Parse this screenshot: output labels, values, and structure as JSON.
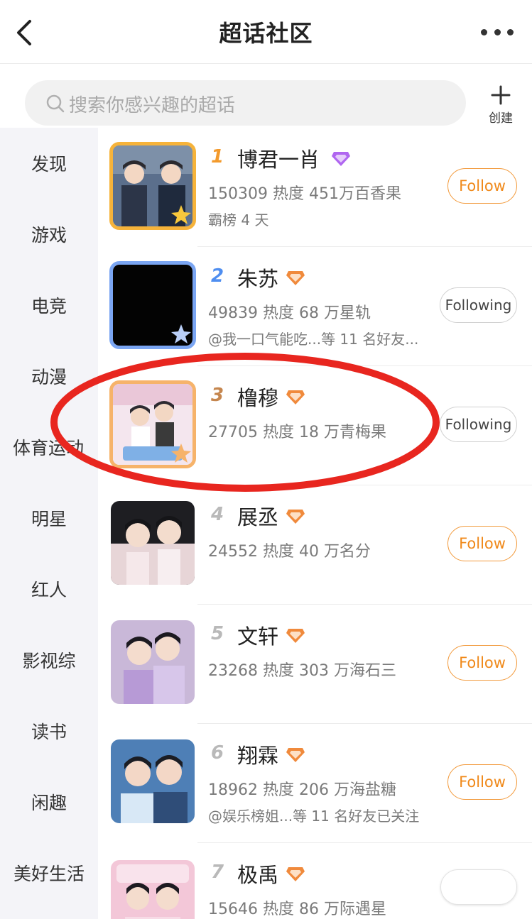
{
  "header": {
    "title": "超话社区",
    "back_icon": "chevron-left-icon",
    "more_icon": "more-dots-icon"
  },
  "search": {
    "placeholder": "搜索你感兴趣的超话",
    "create_label": "创建"
  },
  "sidebar": {
    "items": [
      {
        "label": "发现"
      },
      {
        "label": "游戏"
      },
      {
        "label": "电竞"
      },
      {
        "label": "动漫"
      },
      {
        "label": "体育运动"
      },
      {
        "label": "明星"
      },
      {
        "label": "红人"
      },
      {
        "label": "影视综"
      },
      {
        "label": "读书"
      },
      {
        "label": "闲趣"
      },
      {
        "label": "美好生活"
      }
    ]
  },
  "list": {
    "items": [
      {
        "rank": "1",
        "name": "博君一肖",
        "stats": "150309 热度 451万百香果",
        "sub": "霸榜 4 天",
        "button": "Follow",
        "following": false,
        "rank_color": "#f39a2c",
        "badge_color": "#b066f0"
      },
      {
        "rank": "2",
        "name": "朱苏",
        "stats": "49839 热度 68 万星轨",
        "sub": "@我一口气能吃...等 11 名好友...",
        "button": "Following",
        "following": true,
        "rank_color": "#4f8ef0",
        "badge_color": "#f08a3c"
      },
      {
        "rank": "3",
        "name": "橹穆",
        "stats": "27705 热度 18 万青梅果",
        "sub": "",
        "button": "Following",
        "following": true,
        "rank_color": "#c5864e",
        "badge_color": "#f08a3c"
      },
      {
        "rank": "4",
        "name": "展丞",
        "stats": "24552 热度 40 万名分",
        "sub": "",
        "button": "Follow",
        "following": false,
        "rank_color": "#b9b9b9",
        "badge_color": "#f08a3c"
      },
      {
        "rank": "5",
        "name": "文轩",
        "stats": "23268 热度 303 万海石三",
        "sub": "",
        "button": "Follow",
        "following": false,
        "rank_color": "#b9b9b9",
        "badge_color": "#f08a3c"
      },
      {
        "rank": "6",
        "name": "翔霖",
        "stats": "18962 热度 206 万海盐糖",
        "sub": "@娱乐榜姐...等 11 名好友已关注",
        "button": "Follow",
        "following": false,
        "rank_color": "#b9b9b9",
        "badge_color": "#f08a3c"
      },
      {
        "rank": "7",
        "name": "极禹",
        "stats": "15646 热度 86 万际遇星",
        "sub": "",
        "button": "",
        "following": true,
        "rank_color": "#b9b9b9",
        "badge_color": "#f08a3c"
      }
    ]
  },
  "colors": {
    "accent": "#f0891a",
    "annotation": "#e8261f"
  }
}
